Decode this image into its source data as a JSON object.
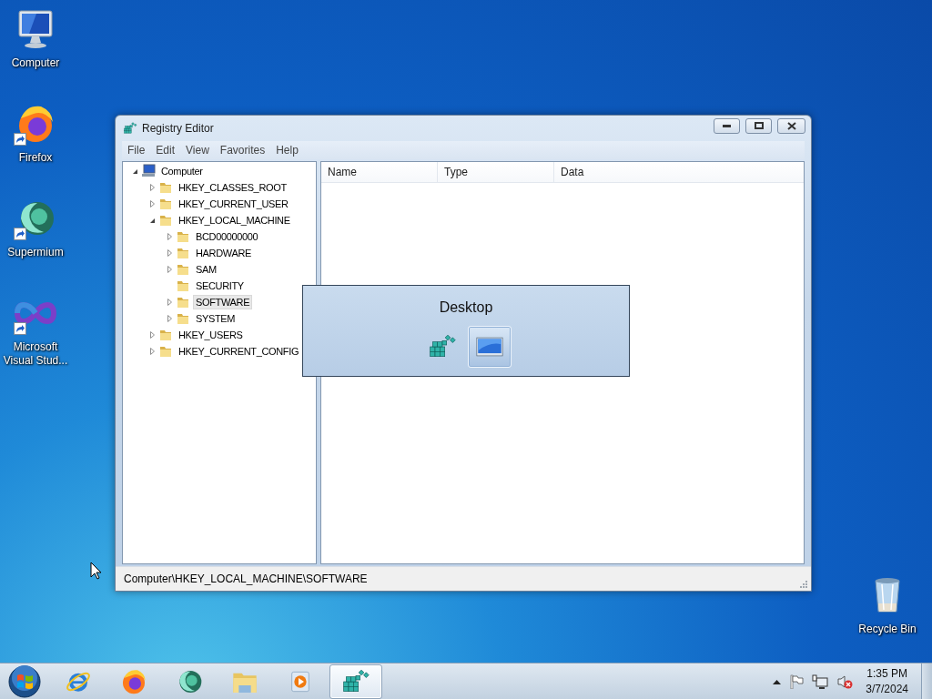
{
  "desktop_icons": [
    {
      "label": "Computer",
      "kind": "computer",
      "shortcut": false
    },
    {
      "label": "Firefox",
      "kind": "firefox",
      "shortcut": true
    },
    {
      "label": "Supermium",
      "kind": "supermium",
      "shortcut": true
    },
    {
      "label": "Microsoft Visual Stud...",
      "kind": "visual-studio",
      "shortcut": true
    },
    {
      "label": "Recycle Bin",
      "kind": "recycle-bin",
      "shortcut": false
    }
  ],
  "window": {
    "title": "Registry Editor",
    "menu": [
      "File",
      "Edit",
      "View",
      "Favorites",
      "Help"
    ],
    "tree": [
      {
        "label": "Computer",
        "kind": "computer",
        "expanded": true,
        "selected": false,
        "children": [
          {
            "label": "HKEY_CLASSES_ROOT",
            "kind": "key",
            "expanded": false,
            "selected": false
          },
          {
            "label": "HKEY_CURRENT_USER",
            "kind": "key",
            "expanded": false,
            "selected": false
          },
          {
            "label": "HKEY_LOCAL_MACHINE",
            "kind": "key",
            "expanded": true,
            "selected": false,
            "children": [
              {
                "label": "BCD00000000",
                "kind": "key",
                "expanded": false,
                "selected": false
              },
              {
                "label": "HARDWARE",
                "kind": "key",
                "expanded": false,
                "selected": false
              },
              {
                "label": "SAM",
                "kind": "key",
                "expanded": false,
                "selected": false
              },
              {
                "label": "SECURITY",
                "kind": "leaf",
                "expanded": false,
                "selected": false
              },
              {
                "label": "SOFTWARE",
                "kind": "key",
                "expanded": false,
                "selected": true
              },
              {
                "label": "SYSTEM",
                "kind": "key",
                "expanded": false,
                "selected": false
              }
            ]
          },
          {
            "label": "HKEY_USERS",
            "kind": "key",
            "expanded": false,
            "selected": false
          },
          {
            "label": "HKEY_CURRENT_CONFIG",
            "kind": "key",
            "expanded": false,
            "selected": false
          }
        ]
      }
    ],
    "columns": [
      "Name",
      "Type",
      "Data"
    ],
    "status_bar": "Computer\\HKEY_LOCAL_MACHINE\\SOFTWARE"
  },
  "switcher": {
    "title": "Desktop",
    "items": [
      {
        "kind": "regedit",
        "selected": false
      },
      {
        "kind": "desktop",
        "selected": true
      }
    ]
  },
  "taskbar": {
    "items": [
      {
        "kind": "ie",
        "selected": false
      },
      {
        "kind": "firefox",
        "selected": false
      },
      {
        "kind": "supermium",
        "selected": false
      },
      {
        "kind": "explorer",
        "selected": false
      },
      {
        "kind": "media",
        "selected": false
      },
      {
        "kind": "regedit",
        "selected": true
      }
    ],
    "tray_icons": [
      {
        "kind": "show-hidden"
      },
      {
        "kind": "flag"
      },
      {
        "kind": "network"
      },
      {
        "kind": "volume-muted"
      }
    ],
    "time": "1:35 PM",
    "date": "3/7/2024"
  }
}
